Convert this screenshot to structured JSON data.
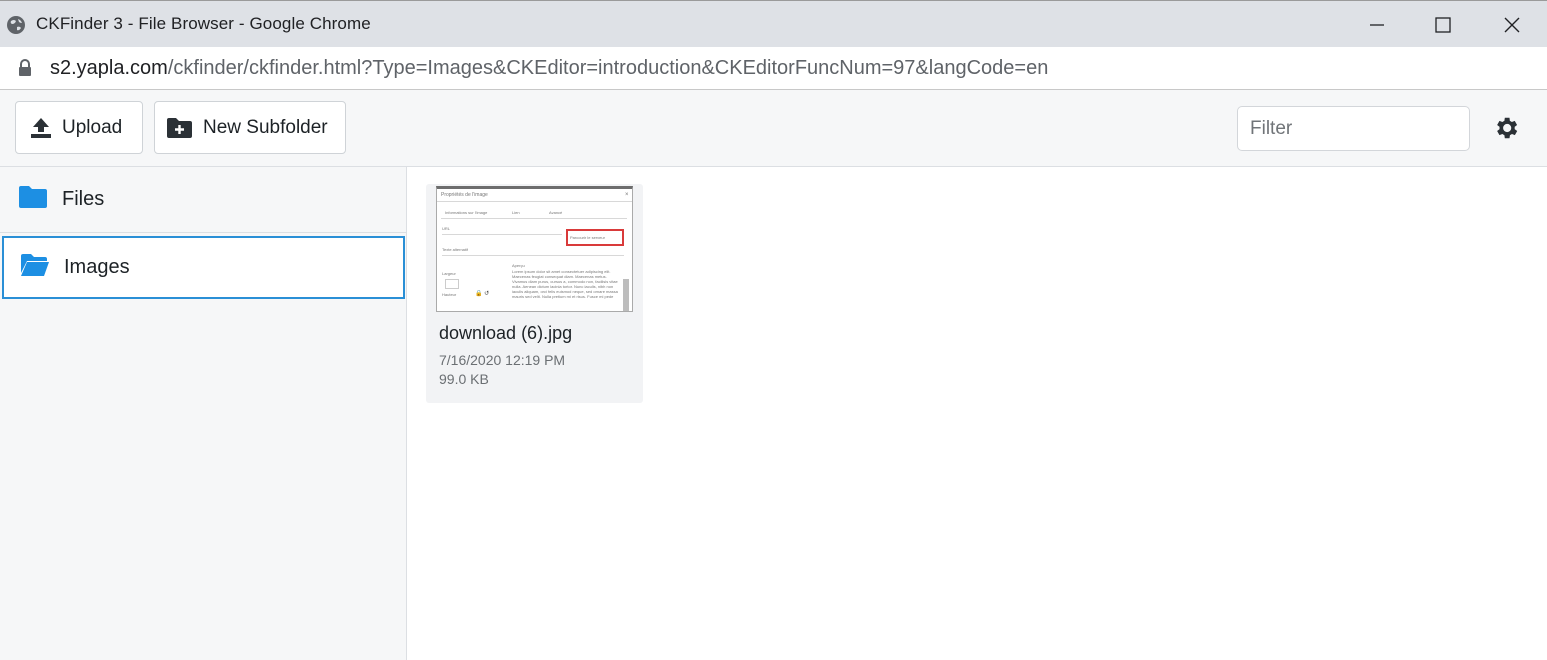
{
  "window": {
    "title": "CKFinder 3 - File Browser - Google Chrome",
    "url_host": "s2.yapla.com",
    "url_path": "/ckfinder/ckfinder.html?Type=Images&CKEditor=introduction&CKEditorFuncNum=97&langCode=en"
  },
  "toolbar": {
    "upload_label": "Upload",
    "new_subfolder_label": "New Subfolder",
    "filter_placeholder": "Filter"
  },
  "sidebar": {
    "items": [
      {
        "label": "Files",
        "icon": "folder-icon",
        "selected": false
      },
      {
        "label": "Images",
        "icon": "folder-open-icon",
        "selected": true
      }
    ]
  },
  "files": [
    {
      "name": "download (6).jpg",
      "date": "7/16/2020 12:19 PM",
      "size": "99.0 KB"
    }
  ],
  "colors": {
    "accent": "#2a8fd6",
    "folder": "#1d8fe3",
    "titlebar": "#dee1e6"
  }
}
